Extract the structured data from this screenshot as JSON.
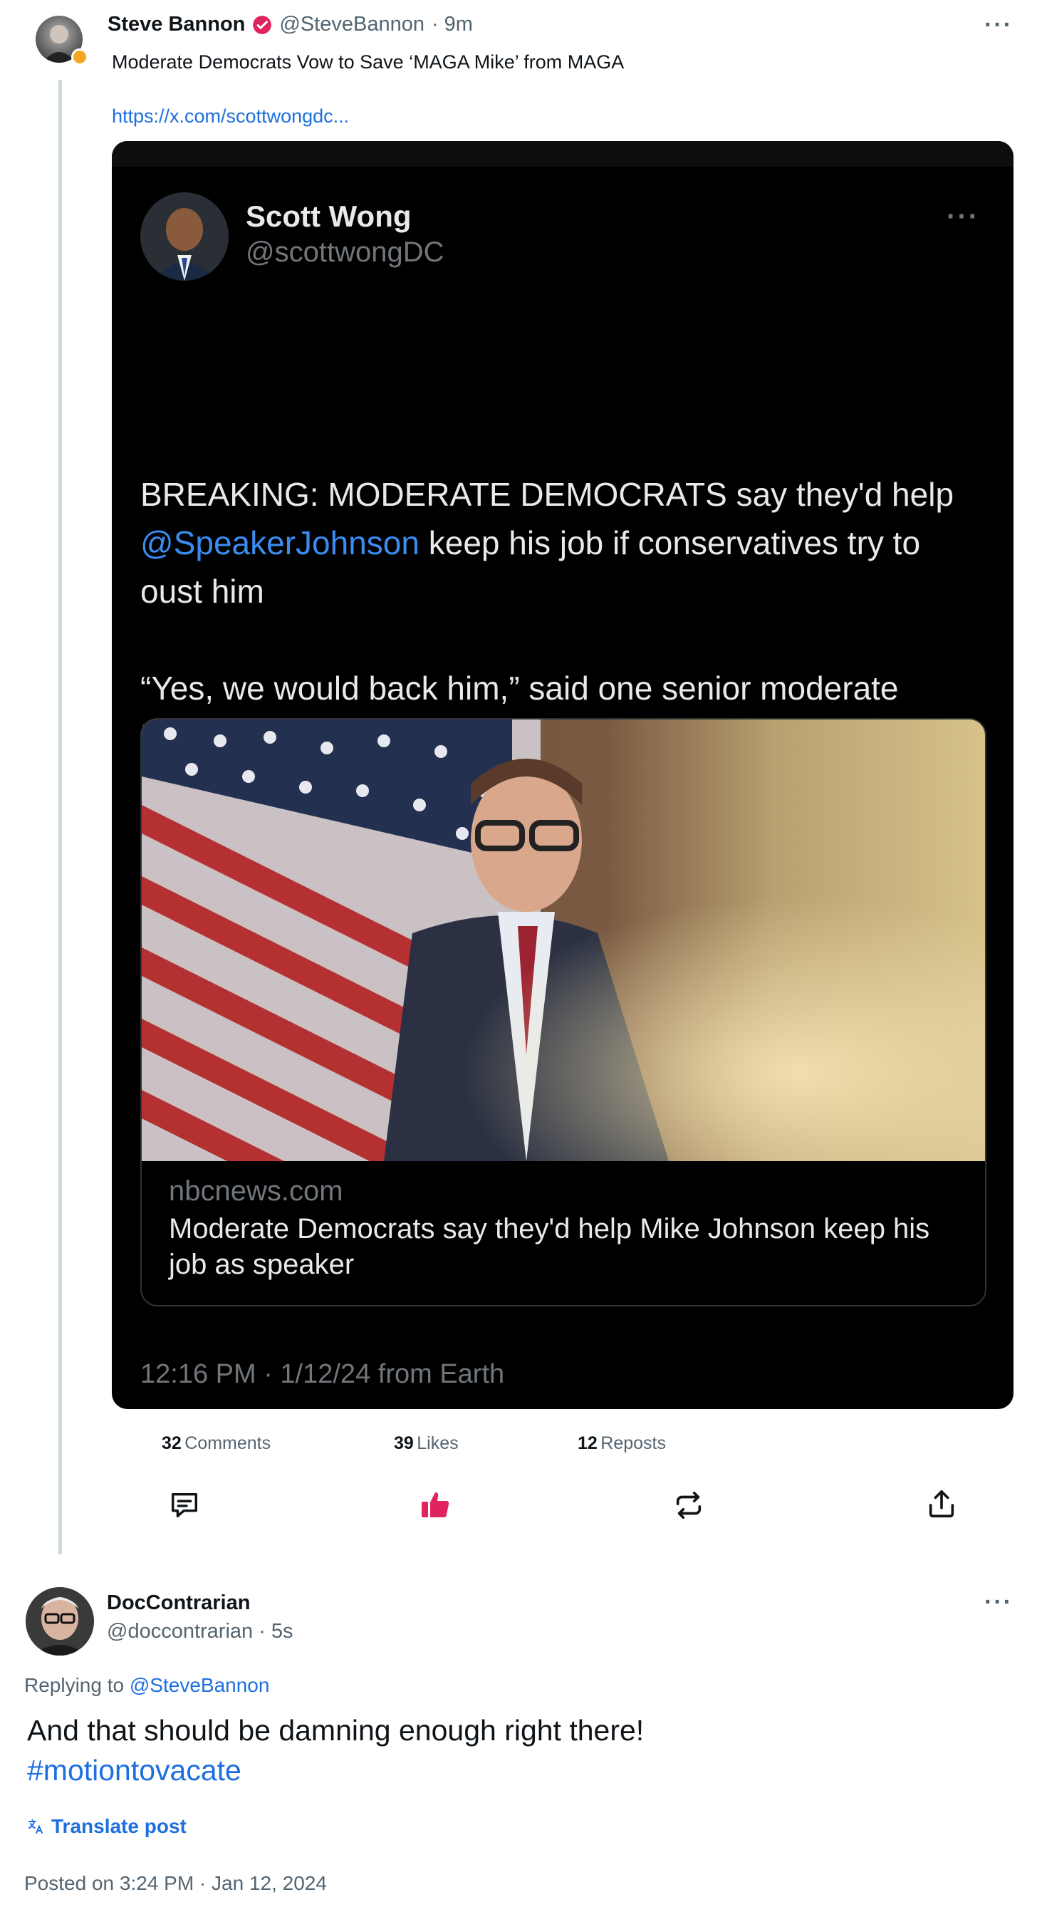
{
  "post": {
    "author_name": "Steve Bannon",
    "author_handle": "@SteveBannon",
    "time": "· 9m",
    "more_label": "···",
    "text": "Moderate Democrats Vow to Save ‘MAGA Mike’ from MAGA",
    "link": "https://x.com/scottwongdc...",
    "verified_color": "#e0245e"
  },
  "embed": {
    "author_name": "Scott Wong",
    "author_handle": "@scottwongDC",
    "more_label": "···",
    "text_part1": "BREAKING: MODERATE DEMOCRATS say they'd help ",
    "mention": "@SpeakerJohnson",
    "text_part2": " keep his job if conservatives try to oust him",
    "quote": "“Yes, we would back him,” said one senior moderate House Democrat who has been speaking with colleagues in his party.",
    "card_domain": "nbcnews.com",
    "card_title": "Moderate Democrats say they'd help Mike Johnson keep his job as speaker",
    "timestamp": "12:16 PM · 1/12/24 from Earth"
  },
  "stats": {
    "comments_count": "32",
    "comments_label": "Comments",
    "likes_count": "39",
    "likes_label": "Likes",
    "reposts_count": "12",
    "reposts_label": "Reposts",
    "like_color": "#e0245e"
  },
  "reply": {
    "author_name": "DocContrarian",
    "author_handle": "@doccontrarian",
    "time": "· 5s",
    "more_label": "···",
    "replying_prefix": "Replying to",
    "replying_to": "@SteveBannon",
    "text": "And that should be damning enough right there!",
    "hashtag": "#motiontovacate",
    "translate_label": "Translate post",
    "posted_on": "Posted on 3:24 PM · Jan 12, 2024"
  }
}
